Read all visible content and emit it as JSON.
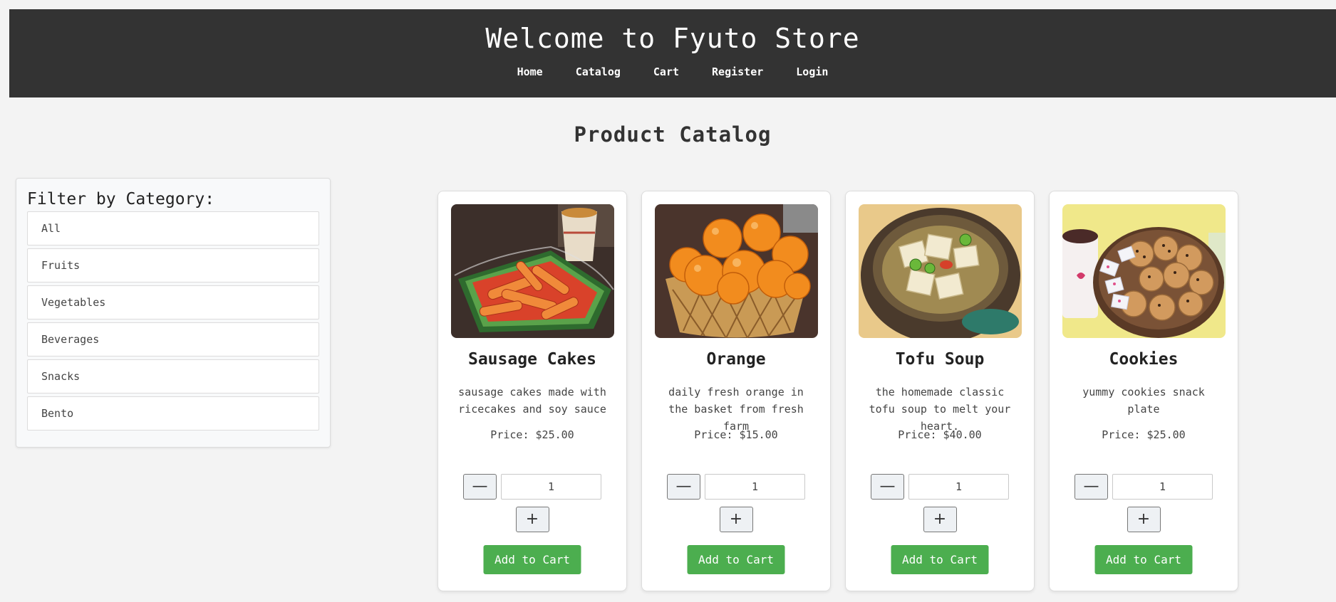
{
  "header": {
    "title": "Welcome to Fyuto Store",
    "nav": [
      "Home",
      "Catalog",
      "Cart",
      "Register",
      "Login"
    ]
  },
  "page_title": "Product Catalog",
  "sidebar": {
    "heading": "Filter by Category:",
    "categories": [
      "All",
      "Fruits",
      "Vegetables",
      "Beverages",
      "Snacks",
      "Bento"
    ]
  },
  "products": [
    {
      "name": "Sausage Cakes",
      "description": "sausage cakes made with ricecakes and soy sauce",
      "price": "Price: $25.00",
      "quantity": "1",
      "add_label": "Add to Cart"
    },
    {
      "name": "Orange",
      "description": "daily fresh orange in the basket from fresh farm",
      "price": "Price: $15.00",
      "quantity": "1",
      "add_label": "Add to Cart"
    },
    {
      "name": "Tofu Soup",
      "description": "the homemade classic tofu soup to melt your heart.",
      "price": "Price: $40.00",
      "quantity": "1",
      "add_label": "Add to Cart"
    },
    {
      "name": "Cookies",
      "description": "yummy cookies snack plate",
      "price": "Price: $25.00",
      "quantity": "1",
      "add_label": "Add to Cart"
    }
  ],
  "steppers": {
    "minus": "—",
    "plus": "+"
  },
  "colors": {
    "header_bg": "#333333",
    "add_button": "#4cae4f",
    "page_bg": "#f3f3f3"
  }
}
